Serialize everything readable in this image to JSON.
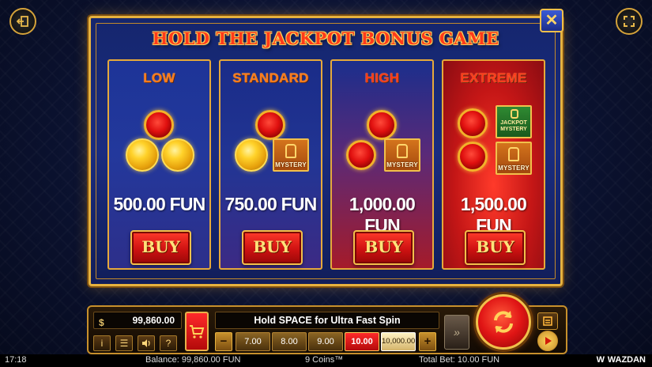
{
  "modal": {
    "title": "HOLD THE JACKPOT BONUS GAME",
    "close_icon": "✕",
    "cards": [
      {
        "label": "LOW",
        "price": "500.00 FUN",
        "buy": "BUY"
      },
      {
        "label": "STANDARD",
        "price": "750.00 FUN",
        "buy": "BUY",
        "mystery": "MYSTERY"
      },
      {
        "label": "HIGH",
        "price": "1,000.00 FUN",
        "buy": "BUY",
        "mystery": "MYSTERY"
      },
      {
        "label": "EXTREME",
        "price": "1,500.00 FUN",
        "buy": "BUY",
        "mystery": "MYSTERY",
        "jackpot_mystery": "JACKPOT MYSTERY"
      }
    ]
  },
  "controls": {
    "balance": "99,860.00",
    "spin_message": "Hold SPACE for Ultra Fast Spin",
    "bet_minus": "−",
    "bet_plus": "+",
    "bet_options": [
      "7.00",
      "8.00",
      "9.00",
      "10.00",
      "10,000.00"
    ],
    "selected_bet": "10.00",
    "buttons": {
      "info": "i",
      "menu": "☰",
      "sound": "🔊",
      "help": "?"
    },
    "turbo": "»"
  },
  "status": {
    "clock": "17:18",
    "balance": "Balance: 99,860.00 FUN",
    "coins": "9 Coins™",
    "total_bet": "Total Bet: 10.00 FUN",
    "brand": "WAZDAN",
    "brand_logo": "W"
  },
  "icons": {
    "exit": "exit-icon",
    "fullscreen": "fullscreen-icon",
    "cart": "cart-icon",
    "spin": "spin-arrows-icon",
    "paytable": "paytable-icon",
    "autoplay": "autoplay-icon"
  }
}
